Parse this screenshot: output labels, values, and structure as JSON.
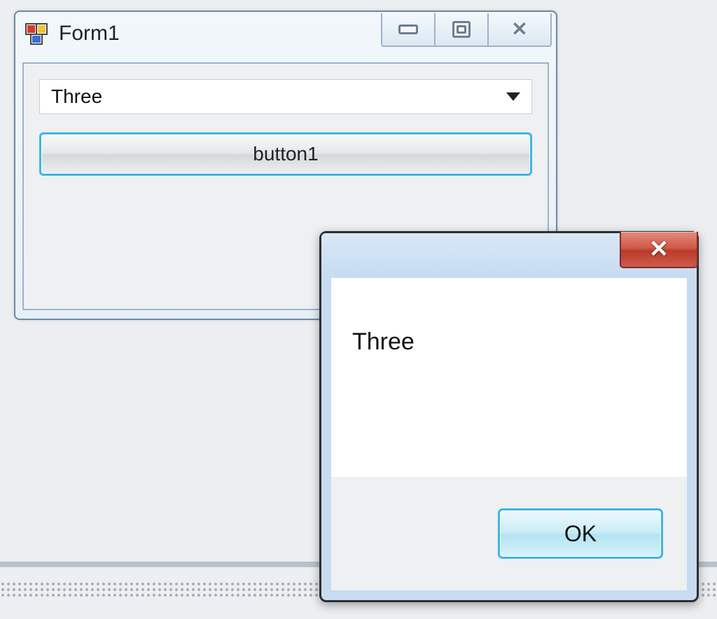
{
  "form": {
    "title": "Form1",
    "combo_value": "Three",
    "button_label": "button1"
  },
  "messagebox": {
    "text": "Three",
    "ok_label": "OK"
  }
}
